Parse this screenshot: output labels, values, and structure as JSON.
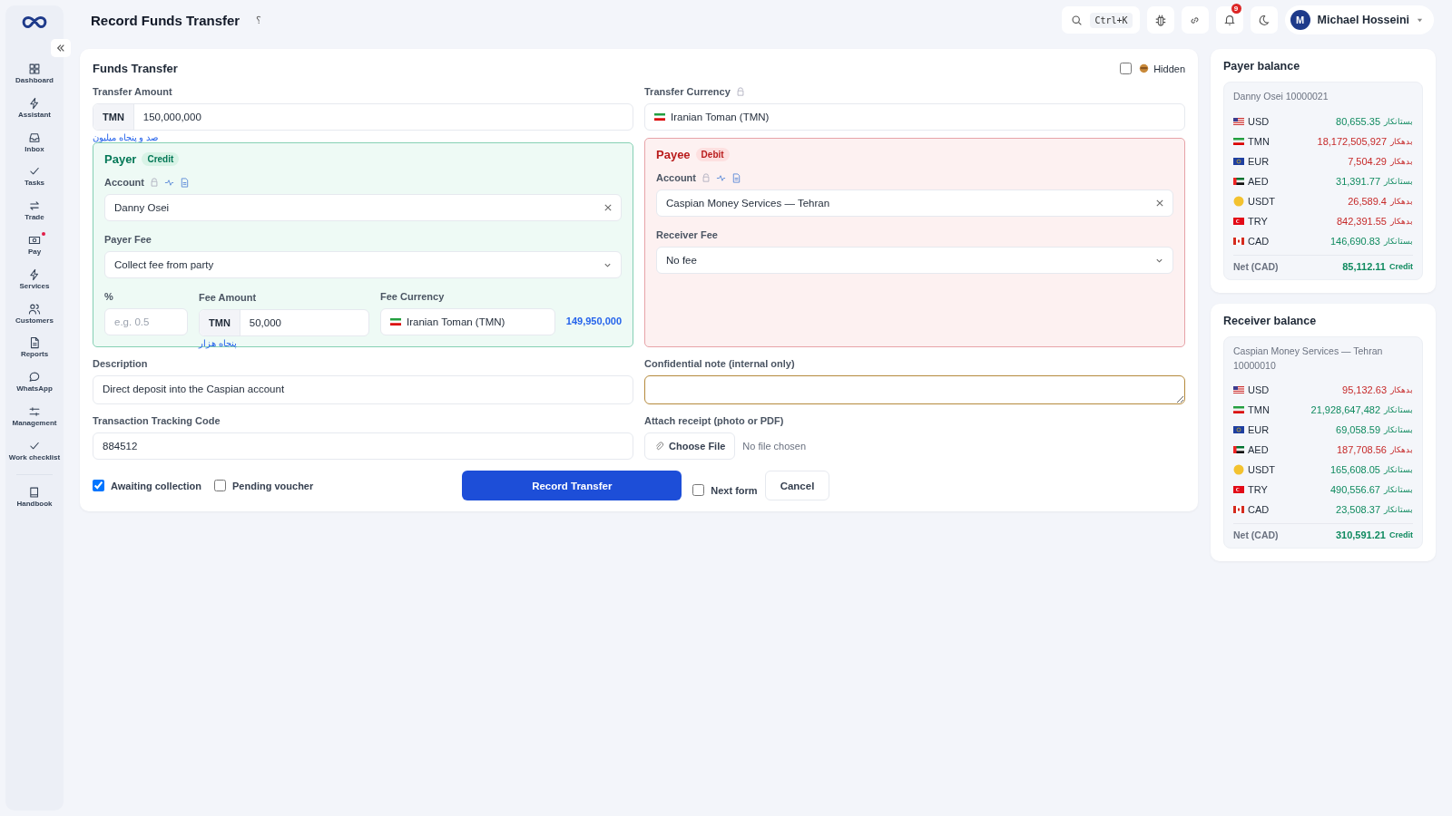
{
  "sidebar": {
    "items": [
      {
        "label": "Dashboard",
        "alert": false
      },
      {
        "label": "Assistant",
        "alert": false
      },
      {
        "label": "Inbox",
        "alert": false
      },
      {
        "label": "Tasks",
        "alert": false
      },
      {
        "label": "Trade",
        "alert": false
      },
      {
        "label": "Pay",
        "alert": true
      },
      {
        "label": "Services",
        "alert": false
      },
      {
        "label": "Customers",
        "alert": false
      },
      {
        "label": "Reports",
        "alert": false
      },
      {
        "label": "WhatsApp",
        "alert": false
      },
      {
        "label": "Management",
        "alert": false
      },
      {
        "label": "Work checklist",
        "alert": false
      },
      {
        "label": "Handbook",
        "alert": false
      }
    ]
  },
  "header": {
    "title": "Record Funds Transfer",
    "help": "؟",
    "search_shortcut": "Ctrl+K",
    "notifications": "9",
    "user": {
      "initial": "M",
      "name": "Michael Hosseini"
    }
  },
  "form": {
    "title": "Funds Transfer",
    "hidden": {
      "label": "Hidden",
      "checked": false
    },
    "amount": {
      "label": "Transfer Amount",
      "currency": "TMN",
      "value": "150,000,000",
      "words": "صد و پنجاه میلیون"
    },
    "currency": {
      "label": "Transfer Currency",
      "value": "Iranian Toman (TMN)"
    },
    "payer": {
      "title": "Payer",
      "tag": "Credit",
      "account_label": "Account",
      "account": "Danny Osei",
      "fee_label": "Payer Fee",
      "fee": "Collect fee from party",
      "percent_label": "%",
      "percent_placeholder": "e.g. 0.5",
      "fee_amount_label": "Fee Amount",
      "fee_amount_currency": "TMN",
      "fee_amount": "50,000",
      "fee_amount_words": "پنجاه هزار",
      "fee_currency_label": "Fee Currency",
      "fee_currency": "Iranian Toman (TMN)",
      "net": "149,950,000"
    },
    "payee": {
      "title": "Payee",
      "tag": "Debit",
      "account_label": "Account",
      "account": "Caspian Money Services — Tehran",
      "fee_label": "Receiver Fee",
      "fee": "No fee"
    },
    "description": {
      "label": "Description",
      "value": "Direct deposit into the Caspian account"
    },
    "note": {
      "label": "Confidential note (internal only)"
    },
    "tracking": {
      "label": "Transaction Tracking Code",
      "value": "884512"
    },
    "receipt": {
      "label": "Attach receipt (photo or PDF)",
      "button": "Choose File",
      "status": "No file chosen"
    },
    "options": [
      {
        "label": "Awaiting collection",
        "checked": true
      },
      {
        "label": "Pending voucher",
        "checked": false
      }
    ],
    "submit": "Record Transfer",
    "next_form": {
      "label": "Next form",
      "checked": false
    },
    "cancel": "Cancel"
  },
  "balances": [
    {
      "title": "Payer balance",
      "account": "Danny Osei 10000021",
      "rows": [
        {
          "code": "USD",
          "amount": "80,655.35",
          "kind": "credit",
          "word": "بستانکار"
        },
        {
          "code": "TMN",
          "amount": "18,172,505,927",
          "kind": "debit",
          "word": "بدهکار"
        },
        {
          "code": "EUR",
          "amount": "7,504.29",
          "kind": "debit",
          "word": "بدهکار"
        },
        {
          "code": "AED",
          "amount": "31,391.77",
          "kind": "credit",
          "word": "بستانکار"
        },
        {
          "code": "USDT",
          "amount": "26,589.4",
          "kind": "debit",
          "word": "بدهکار"
        },
        {
          "code": "TRY",
          "amount": "842,391.55",
          "kind": "debit",
          "word": "بدهکار"
        },
        {
          "code": "CAD",
          "amount": "146,690.83",
          "kind": "credit",
          "word": "بستانکار"
        }
      ],
      "net_label": "Net (CAD)",
      "net": "85,112.11",
      "net_tag": "Credit"
    },
    {
      "title": "Receiver balance",
      "account": "Caspian Money Services — Tehran 10000010",
      "rows": [
        {
          "code": "USD",
          "amount": "95,132.63",
          "kind": "debit",
          "word": "بدهکار"
        },
        {
          "code": "TMN",
          "amount": "21,928,647,482",
          "kind": "credit",
          "word": "بستانکار"
        },
        {
          "code": "EUR",
          "amount": "69,058.59",
          "kind": "credit",
          "word": "بستانکار"
        },
        {
          "code": "AED",
          "amount": "187,708.56",
          "kind": "debit",
          "word": "بدهکار"
        },
        {
          "code": "USDT",
          "amount": "165,608.05",
          "kind": "credit",
          "word": "بستانکار"
        },
        {
          "code": "TRY",
          "amount": "490,556.67",
          "kind": "credit",
          "word": "بستانکار"
        },
        {
          "code": "CAD",
          "amount": "23,508.37",
          "kind": "credit",
          "word": "بستانکار"
        }
      ],
      "net_label": "Net (CAD)",
      "net": "310,591.21",
      "net_tag": "Credit"
    }
  ]
}
